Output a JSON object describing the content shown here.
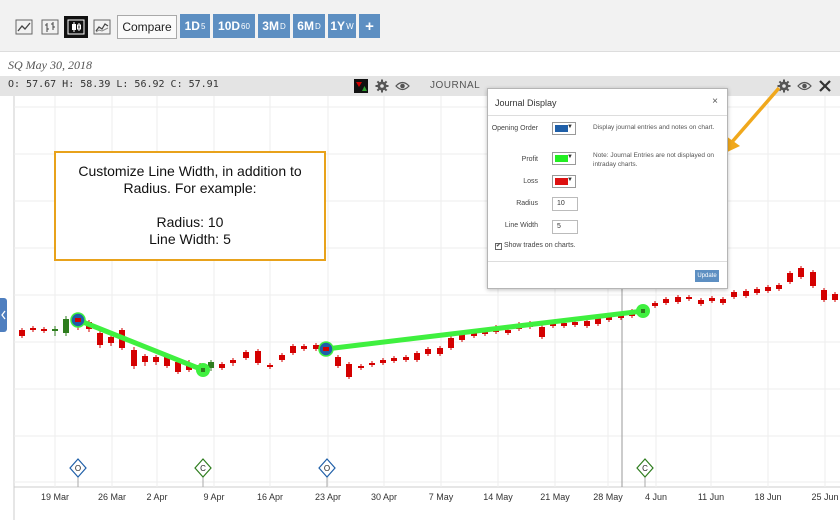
{
  "toolbar": {
    "compare_label": "Compare",
    "ranges": [
      {
        "main": "1D",
        "sub": "5"
      },
      {
        "main": "10D",
        "sub": "60"
      },
      {
        "main": "3M",
        "sub": "D"
      },
      {
        "main": "6M",
        "sub": "D"
      },
      {
        "main": "1Y",
        "sub": "W"
      },
      {
        "main": "+",
        "sub": ""
      }
    ]
  },
  "symbol_line": "SQ  May 30, 2018",
  "ohlc_text": "O: 57.67 H: 58.39 L: 56.92 C: 57.91",
  "journal_label": "JOURNAL",
  "callout": {
    "line1": "Customize Line Width, in addition to",
    "line2": "Radius. For example:",
    "line3": "Radius:  10",
    "line4": "Line Width: 5"
  },
  "dialog": {
    "title": "Journal Display",
    "close": "×",
    "opening_order_label": "Opening Order",
    "profit_label": "Profit",
    "loss_label": "Loss",
    "radius_label": "Radius",
    "radius_value": "10",
    "line_width_label": "Line Width",
    "line_width_value": "5",
    "note1": "Display journal entries and notes on chart.",
    "note2": "Note: Journal Entries are not displayed on intraday charts.",
    "show_trades": "Show trades on charts.",
    "update_label": "Update",
    "colors": {
      "opening_order": "#1f5fa8",
      "profit": "#22ee22",
      "loss": "#dd1111"
    }
  },
  "x_axis_labels": [
    "19 Mar",
    "26 Mar",
    "2 Apr",
    "9 Apr",
    "16 Apr",
    "23 Apr",
    "30 Apr",
    "7 May",
    "14 May",
    "21 May",
    "28 May",
    "4 Jun",
    "11 Jun",
    "18 Jun",
    "25 Jun"
  ],
  "markers": [
    "O",
    "C",
    "O",
    "C"
  ],
  "colors": {
    "up": "#2e7d1e",
    "down": "#d40000",
    "trade_line": "#3ff03f",
    "accent": "#5d8fc2",
    "callout_border": "#e8a21b",
    "arrow": "#f0a81c"
  }
}
